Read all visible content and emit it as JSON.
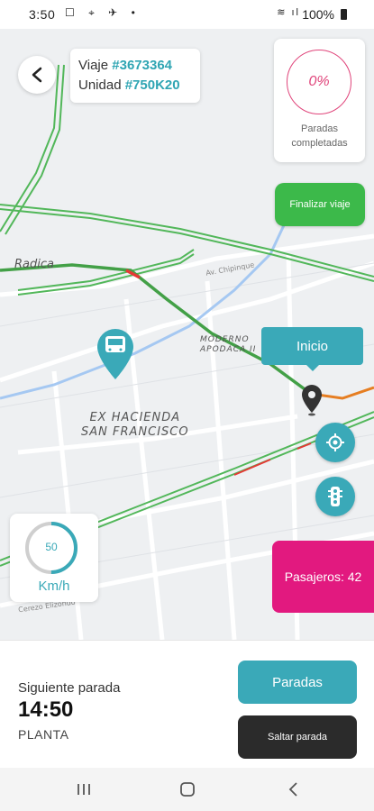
{
  "status_bar": {
    "time": "3:50",
    "left_icons": "☐ ⌖ ✈ •",
    "signal_icons": "≋ ıl",
    "battery": "100%"
  },
  "map": {
    "labels": {
      "radica": "Radica",
      "hacienda_line1": "EX HACIENDA",
      "hacienda_line2": "SAN FRANCISCO",
      "moderno_line1": "MODERNO",
      "moderno_line2": "APODACA II",
      "street_chipi": "Av. Chipinque",
      "street_cerezo": "Cerezo Elizondo"
    },
    "route_color": "#4caf50",
    "accent_color": "#3aa9b8"
  },
  "trip": {
    "viaje_label": "Viaje",
    "viaje_value": "#3673364",
    "unidad_label": "Unidad",
    "unidad_value": "#750K20"
  },
  "progress": {
    "percent_text": "0%",
    "label_line1": "Paradas",
    "label_line2": "completadas"
  },
  "buttons": {
    "finalizar": "Finalizar viaje",
    "paradas": "Paradas",
    "saltar": "Saltar parada"
  },
  "marker_tip": "Inicio",
  "speed": {
    "value": "50",
    "unit": "Km/h",
    "gauge_fraction": 0.5
  },
  "passengers": {
    "label": "Pasajeros: 42"
  },
  "next_stop": {
    "title": "Siguiente parada",
    "time": "14:50",
    "place": "PLANTA"
  }
}
